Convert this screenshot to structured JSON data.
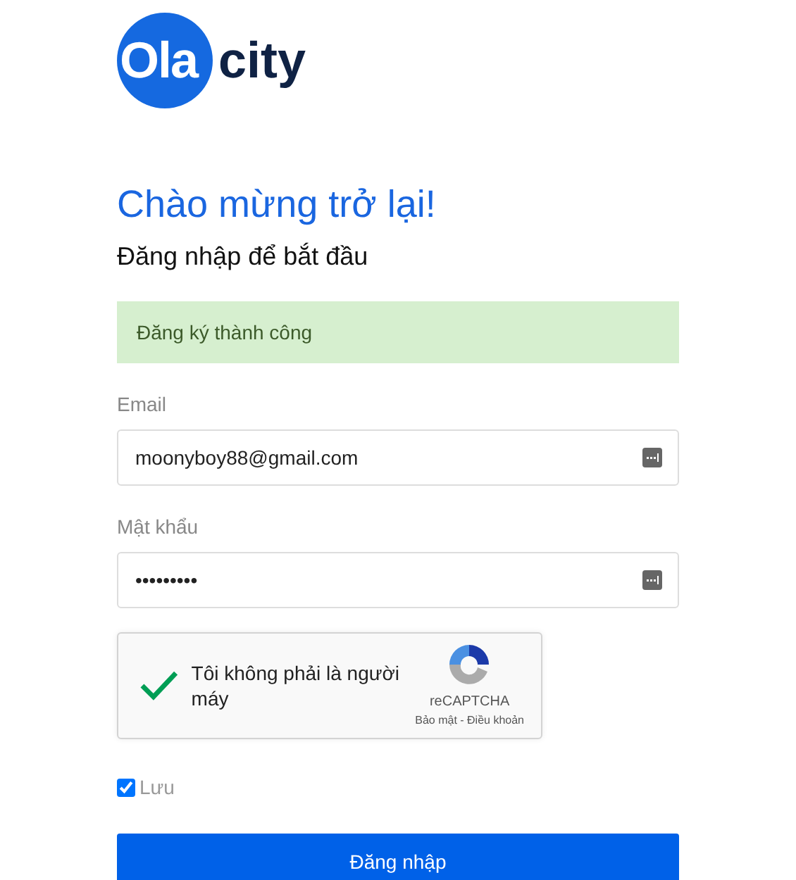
{
  "logo": {
    "part_1": "Ola",
    "part_2": "city"
  },
  "heading": "Chào mừng trở lại!",
  "subheading": "Đăng nhập để bắt đầu",
  "alert": {
    "text": "Đăng ký thành công"
  },
  "fields": [
    {
      "label": "Email",
      "value": "moonyboy88@gmail.com"
    },
    {
      "label": "Mật khẩu",
      "value": "•••••••••"
    }
  ],
  "captcha": {
    "label": "Tôi không phải là người máy",
    "checked": true,
    "brand": "reCAPTCHA",
    "links": "Bảo mật - Điều khoản"
  },
  "remember": {
    "label": "Lưu",
    "checked": true
  },
  "submit": "Đăng nhập"
}
